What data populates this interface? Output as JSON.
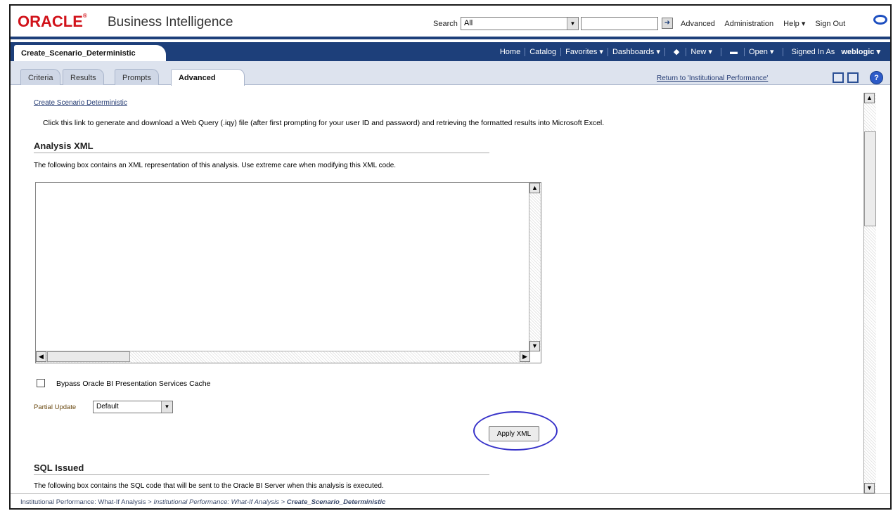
{
  "header": {
    "logo_text": "ORACLE",
    "logo_mark": "®",
    "product": "Business Intelligence",
    "search_label": "Search",
    "search_scope": "All",
    "search_value": "",
    "links": [
      "Advanced",
      "Administration",
      "Help ▾",
      "Sign Out"
    ]
  },
  "nav": {
    "document_tab": "Create_Scenario_Deterministic",
    "items": [
      "Home",
      "Catalog",
      "Favorites ▾",
      "Dashboards ▾",
      "New ▾",
      "Open ▾"
    ],
    "signed_in_label": "Signed In As",
    "user": "weblogic ▾"
  },
  "tabs": [
    "Criteria",
    "Results",
    "Prompts",
    "Advanced"
  ],
  "active_tab": "Advanced",
  "return_link": "Return to 'Institutional Performance'",
  "help_label": "?",
  "content": {
    "create_link": "Create Scenario Deterministic",
    "intro": "Click this link to generate and download a Web Query (.iqy) file (after first prompting for your user ID and password) and retrieving the formatted results into Microsoft Excel.",
    "analysis_title": "Analysis XML",
    "analysis_desc": "The following box contains an XML representation of this analysis. Use extreme care when modifying this XML code.",
    "xml_value": "",
    "bypass_label": "Bypass Oracle BI Presentation Services Cache",
    "bypass_checked": false,
    "partial_update_label": "Partial Update",
    "partial_update_value": "Default",
    "apply_button": "Apply XML",
    "sql_title": "SQL Issued",
    "sql_desc": "The following box contains the SQL code that will be sent to the Oracle BI Server when this analysis is executed."
  },
  "status_bar": {
    "crumb_1": "Institutional Performance: What-If Analysis",
    "sep": ">",
    "crumb_2": "Institutional Performance: What-If Analysis",
    "crumb_3": "Create_Scenario_Deterministic"
  },
  "colors": {
    "brand_red": "#d1121a",
    "nav_blue": "#1d3f7a",
    "link_blue": "#243b73",
    "highlight": "#3732c9"
  }
}
